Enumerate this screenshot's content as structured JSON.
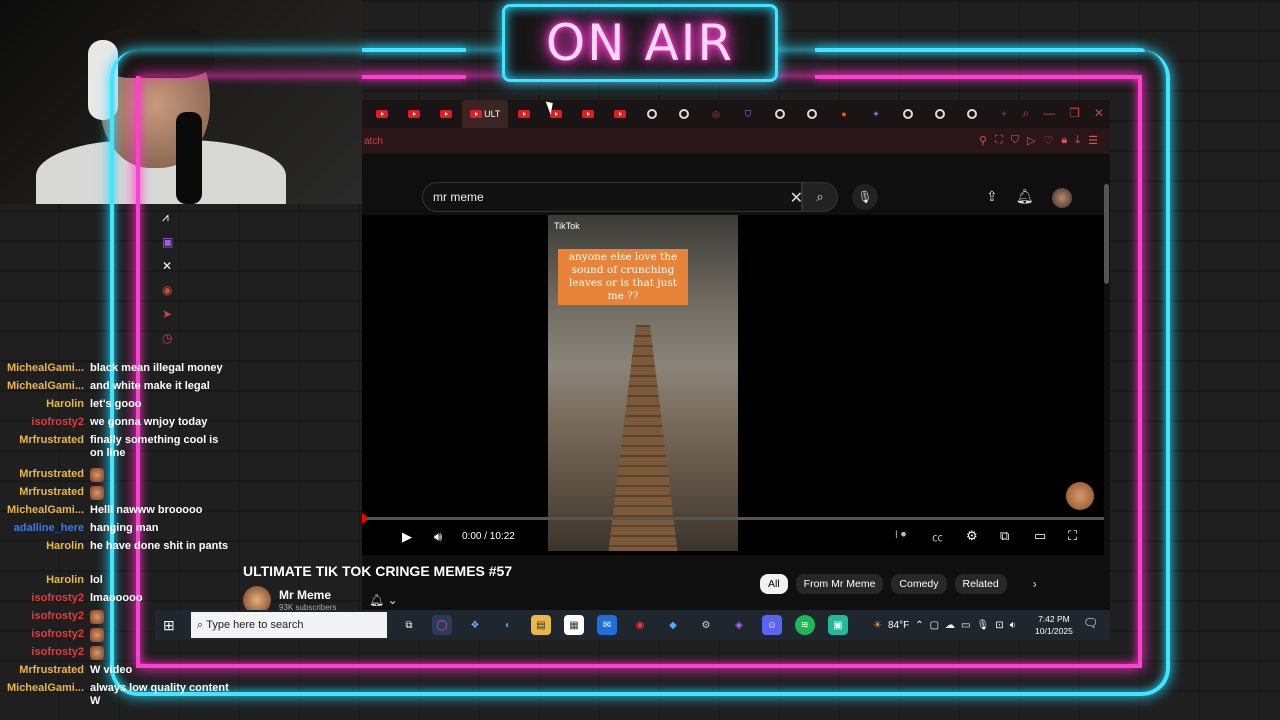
{
  "overlay": {
    "sign_text": "ON AIR",
    "neon_cyan": "#3fe6ff",
    "neon_pink": "#ff3fd0"
  },
  "browser": {
    "active_tab_label": "ULT",
    "address_text": "atch",
    "search_value": "mr meme"
  },
  "player": {
    "video_overlay_brand": "TikTok",
    "caption": "anyone else love the sound of crunching leaves or is that just me ??",
    "time": "0:00 / 10:22",
    "progress": 0
  },
  "video_info": {
    "title": "ULTIMATE TIK TOK CRINGE MEMES #57",
    "channel_name": "Mr Meme",
    "subscribers": "93K subscribers"
  },
  "chips": [
    {
      "label": "All"
    },
    {
      "label": "From Mr Meme"
    },
    {
      "label": "Comedy"
    },
    {
      "label": "Related"
    }
  ],
  "taskbar": {
    "search_placeholder": "Type here to search",
    "weather": "84°F",
    "time": "7:42 PM",
    "date": "10/1/2025"
  },
  "chat": [
    {
      "user": "MichealGami...",
      "color": "#e8b84a",
      "text": "black mean illegal money"
    },
    {
      "user": "MichealGami...",
      "color": "#e8b84a",
      "text": "and white make it legal"
    },
    {
      "user": "Harolin",
      "color": "#e8b84a",
      "text": "let's gooo"
    },
    {
      "user": "isofrosty2",
      "color": "#e83a3a",
      "text": "we gonna wnjoy today"
    },
    {
      "user": "Mrfrustrated",
      "color": "#e8b84a",
      "text": "finally something cool is on line"
    },
    {
      "user": "Mrfrustrated",
      "color": "#e8b84a",
      "text": "",
      "emote": true
    },
    {
      "user": "Mrfrustrated",
      "color": "#e8b84a",
      "text": "",
      "emote": true
    },
    {
      "user": "MichealGami...",
      "color": "#e8b84a",
      "text": "Helll nawww brooooo"
    },
    {
      "user": "adalline_here",
      "color": "#3a7ae8",
      "text": "hanging man"
    },
    {
      "user": "Harolin",
      "color": "#e8b84a",
      "text": "he have done shit in pants"
    },
    {
      "user": "Harolin",
      "color": "#e8b84a",
      "text": "lol"
    },
    {
      "user": "isofrosty2",
      "color": "#e83a3a",
      "text": "lmaooooo"
    },
    {
      "user": "isofrosty2",
      "color": "#e83a3a",
      "text": "",
      "emote": true
    },
    {
      "user": "isofrosty2",
      "color": "#e83a3a",
      "text": "",
      "emote": true
    },
    {
      "user": "isofrosty2",
      "color": "#e83a3a",
      "text": "",
      "emote": true
    },
    {
      "user": "Mrfrustrated",
      "color": "#e8b84a",
      "text": "W video"
    },
    {
      "user": "MichealGami...",
      "color": "#e8b84a",
      "text": "always low quality content W"
    }
  ]
}
